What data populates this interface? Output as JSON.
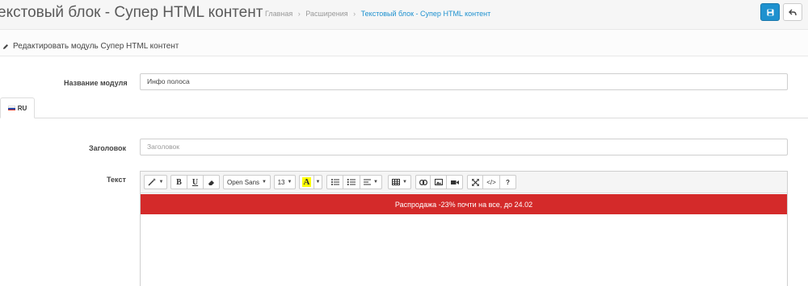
{
  "header": {
    "title": "екстовый блок - Супер HTML контент",
    "breadcrumb": [
      {
        "label": "Главная"
      },
      {
        "label": "Расширения"
      },
      {
        "label": "Текстовый блок - Супер HTML контент"
      }
    ],
    "breadcrumb_separator": "›",
    "save_icon": "save-icon",
    "back_icon": "reply-icon",
    "accent_color": "#1e91cf"
  },
  "panel": {
    "title": "Редактировать модуль Супер HTML контент",
    "title_icon": "pencil-icon"
  },
  "form": {
    "module_name_label": "Название модуля",
    "module_name_value": "Инфо полоса",
    "language_tab": "RU",
    "heading_label": "Заголовок",
    "heading_placeholder": "Заголовок",
    "text_label": "Текст"
  },
  "editor": {
    "toolbar": {
      "magic": "magic-wand-icon",
      "bold": "B",
      "underline": "U",
      "eraser": "eraser-icon",
      "font_family": "Open Sans",
      "font_size": "13",
      "color": "A",
      "ul": "unordered-list-icon",
      "ol": "ordered-list-icon",
      "align": "align-icon",
      "table": "table-icon",
      "link": "link-icon",
      "picture": "picture-icon",
      "video": "video-icon",
      "fullscreen": "fullscreen-icon",
      "code": "</>",
      "help": "?"
    },
    "banner_text": "Распродажа -23% почти на все, до 24.02",
    "banner_color": "#d42a2a"
  }
}
